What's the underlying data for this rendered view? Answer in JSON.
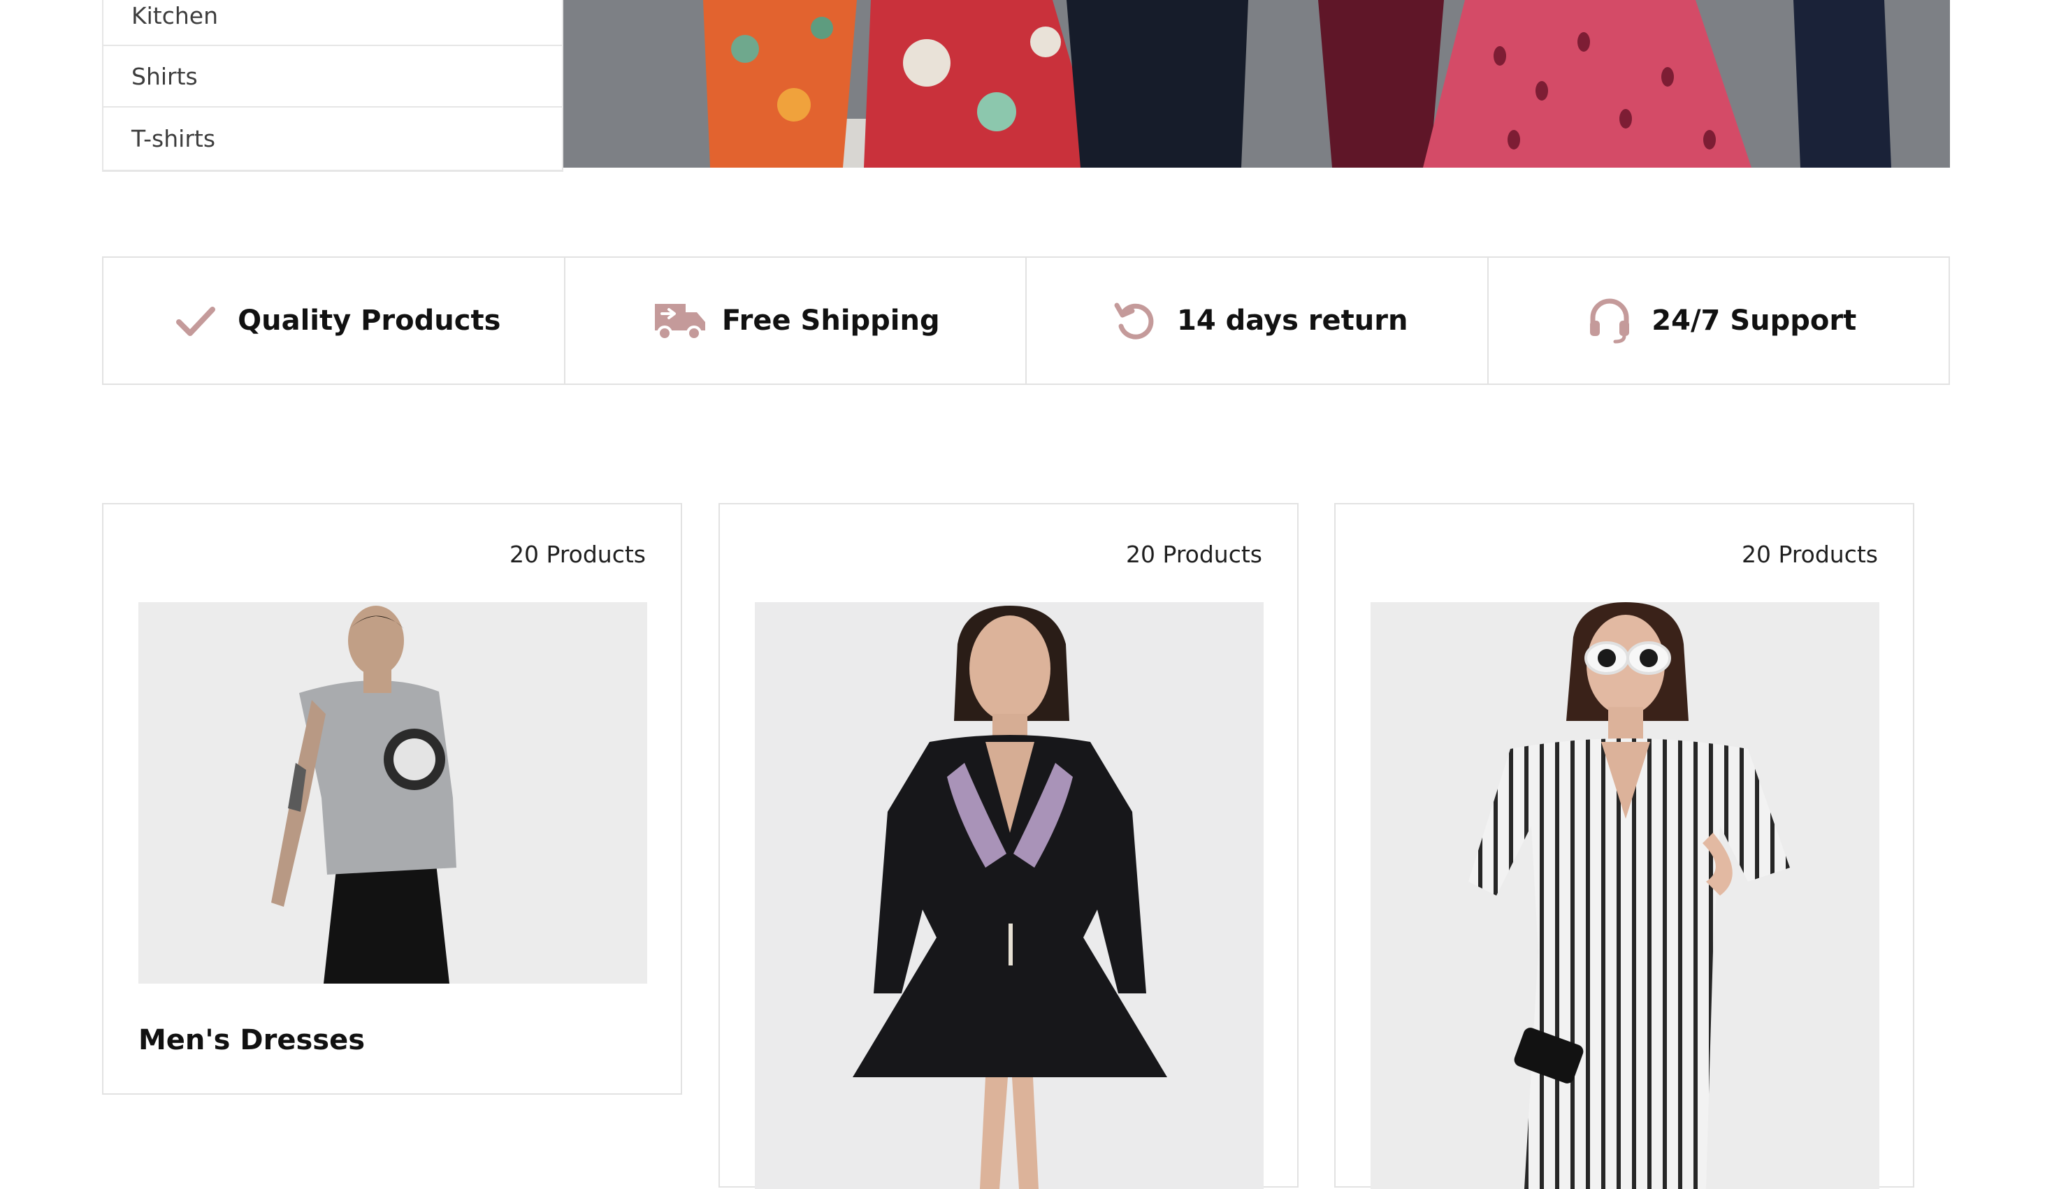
{
  "sidebar": {
    "items": [
      {
        "label": "Kitchen"
      },
      {
        "label": "Shirts"
      },
      {
        "label": "T-shirts"
      }
    ]
  },
  "features": [
    {
      "label": "Quality Products",
      "icon": "check-icon"
    },
    {
      "label": "Free Shipping",
      "icon": "truck-icon"
    },
    {
      "label": "14 days return",
      "icon": "return-icon"
    },
    {
      "label": "24/7 Support",
      "icon": "headset-icon"
    }
  ],
  "categories": [
    {
      "count": "20 Products",
      "title": "Men's Dresses"
    },
    {
      "count": "20 Products",
      "title": ""
    },
    {
      "count": "20 Products",
      "title": ""
    }
  ],
  "colors": {
    "accent": "#c49a9a",
    "border": "#e2e2e2",
    "text": "#111111"
  }
}
